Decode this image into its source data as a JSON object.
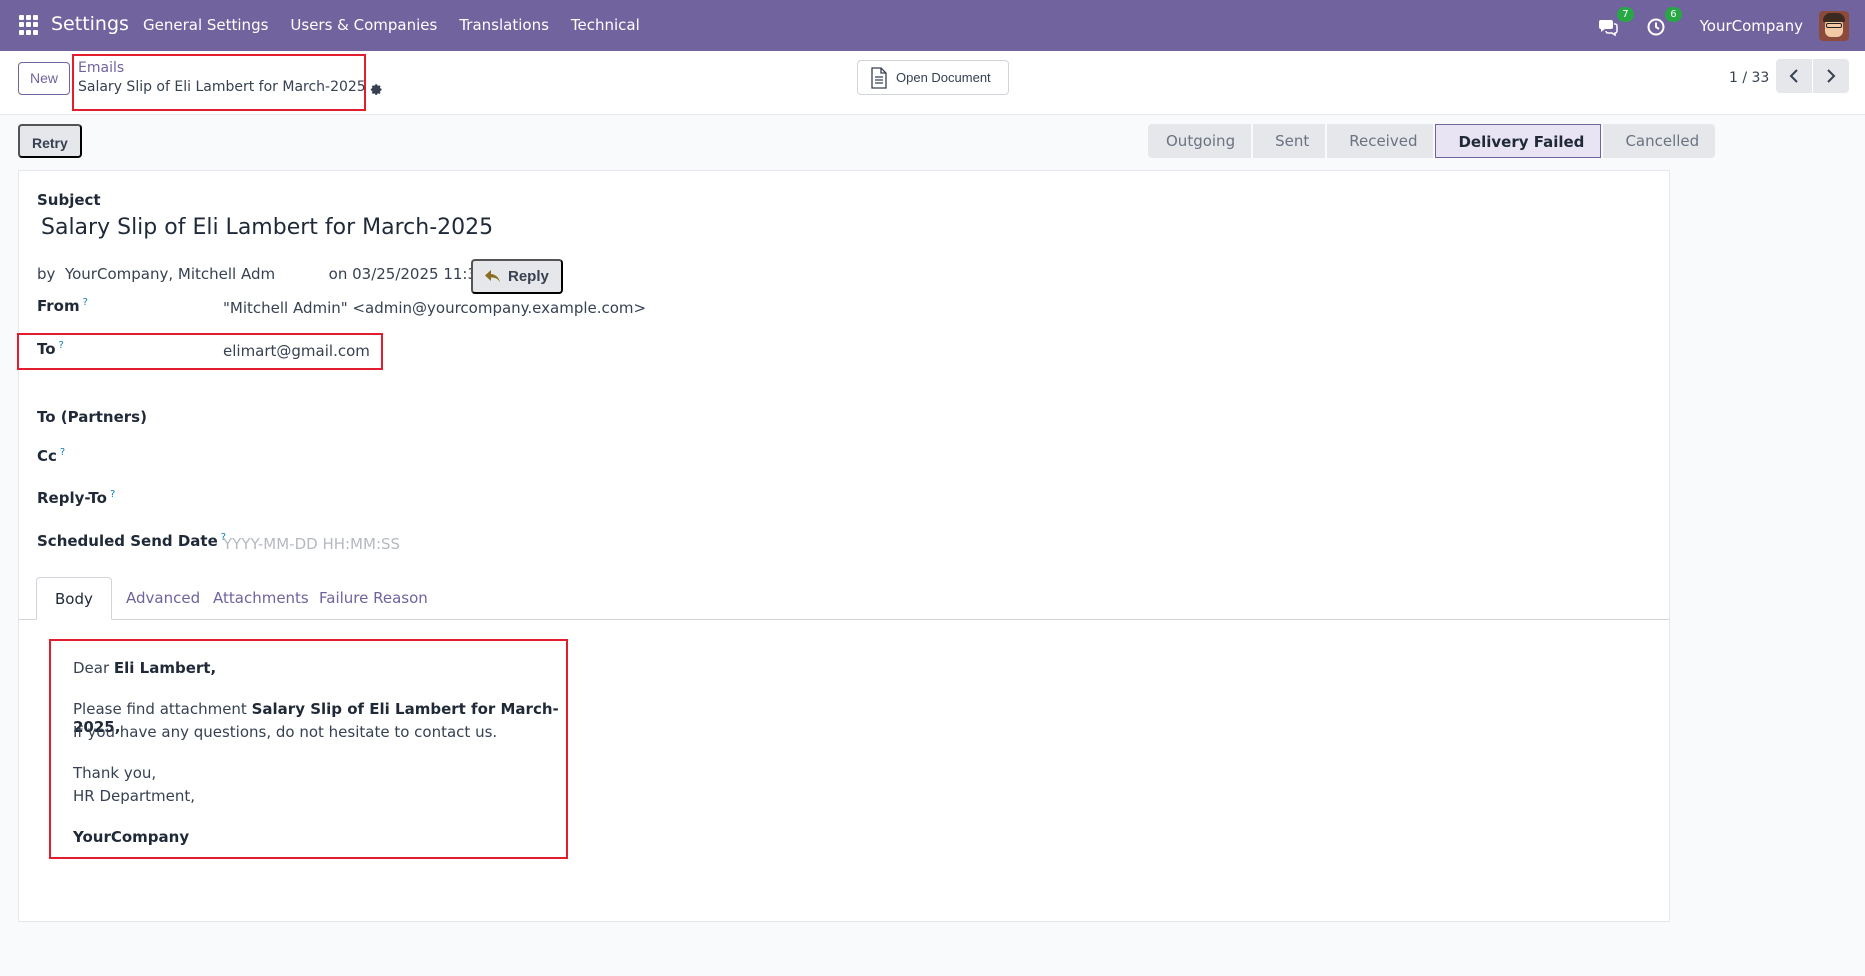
{
  "navbar": {
    "brand": "Settings",
    "menu": [
      "General Settings",
      "Users & Companies",
      "Translations",
      "Technical"
    ],
    "messages_count": "7",
    "activities_count": "6",
    "company": "YourCompany"
  },
  "control": {
    "new_label": "New",
    "breadcrumb_parent": "Emails",
    "breadcrumb_current": "Salary Slip of Eli Lambert for March-2025",
    "open_document_label": "Open Document",
    "pager": "1 / 33"
  },
  "status": {
    "retry_label": "Retry",
    "stages": [
      "Outgoing",
      "Sent",
      "Received",
      "Delivery Failed",
      "Cancelled"
    ],
    "active_stage": "Delivery Failed"
  },
  "form": {
    "subject_label": "Subject",
    "subject": "Salary Slip of Eli Lambert for March-2025",
    "by_prefix": "by",
    "author": "YourCompany, Mitchell Adm",
    "date_prefix": "on",
    "date": "03/25/2025 11:34:15",
    "reply_label": "Reply",
    "from_label": "From",
    "from_value": "\"Mitchell Admin\" <admin@yourcompany.example.com>",
    "to_label": "To",
    "to_value": "elimart@gmail.com",
    "to_partners_label": "To (Partners)",
    "cc_label": "Cc",
    "reply_to_label": "Reply-To",
    "scheduled_label": "Scheduled Send Date",
    "scheduled_placeholder": "YYYY-MM-DD HH:MM:SS",
    "help_mark": "?"
  },
  "tabs": [
    "Body",
    "Advanced",
    "Attachments",
    "Failure Reason"
  ],
  "body": {
    "greeting": "Dear",
    "recipient": "Eli Lambert,",
    "line1_prefix": "Please find attachment",
    "line1_bold": "Salary Slip of Eli Lambert for March-2025,",
    "line2": "If you have any questions, do not hesitate to contact us.",
    "thanks": "Thank you,",
    "department": "HR Department,",
    "signature": "YourCompany"
  }
}
